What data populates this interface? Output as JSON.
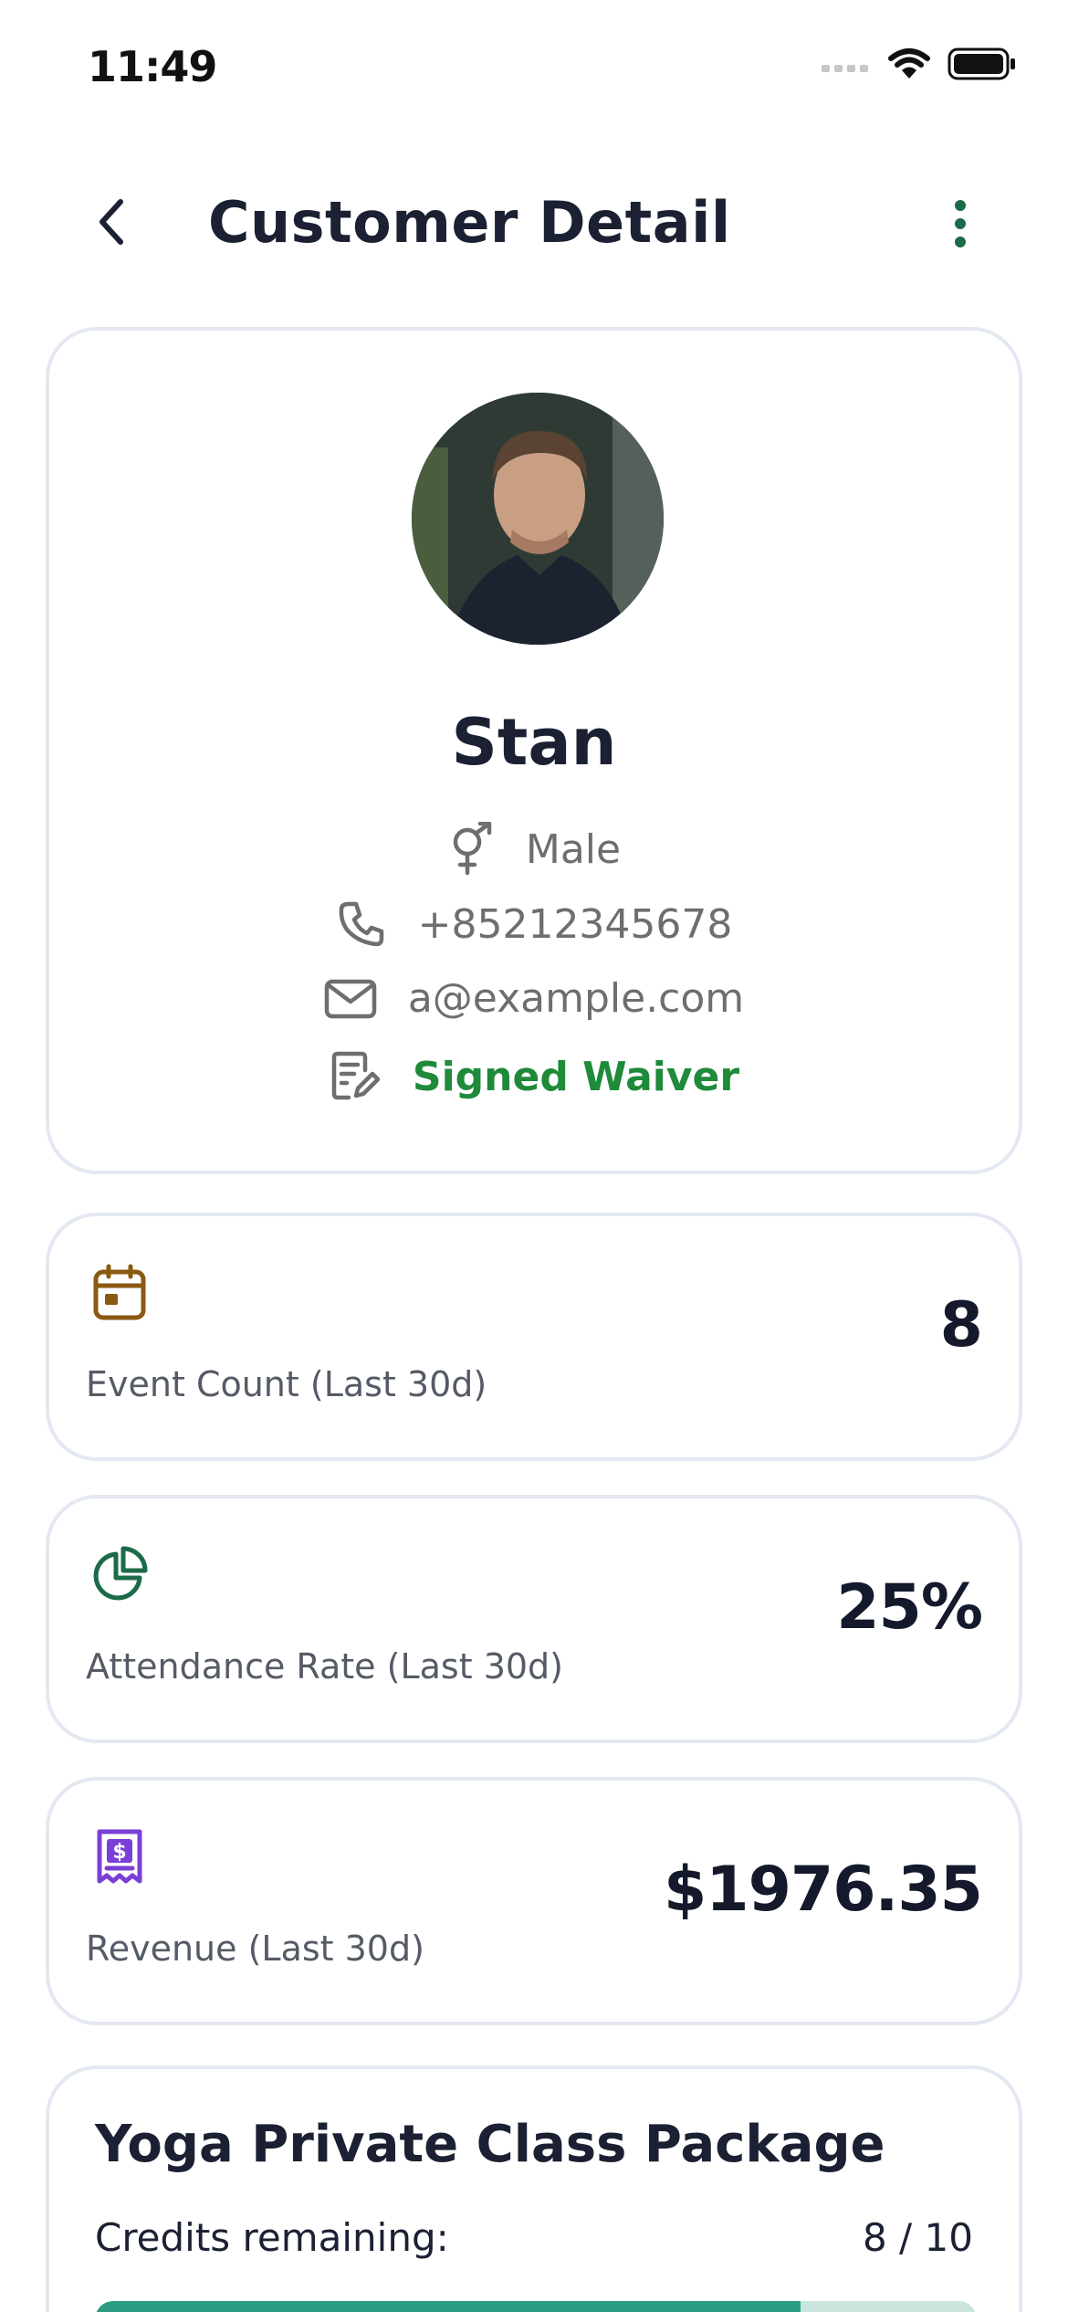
{
  "status_bar": {
    "time": "11:49"
  },
  "header": {
    "title": "Customer Detail"
  },
  "profile": {
    "name": "Stan",
    "gender": "Male",
    "phone": "+85212345678",
    "email": "a@example.com",
    "waiver": "Signed Waiver"
  },
  "stats": [
    {
      "label": "Event Count (Last 30d)",
      "value": "8",
      "icon": "calendar-icon",
      "color": "#8a5a12"
    },
    {
      "label": "Attendance Rate (Last 30d)",
      "value": "25%",
      "icon": "pie-chart-icon",
      "color": "#1c6b48"
    },
    {
      "label": "Revenue (Last 30d)",
      "value": "$1976.35",
      "icon": "receipt-icon",
      "color": "#7a3fd6"
    }
  ],
  "package": {
    "title": "Yoga Private Class Package",
    "credits_label": "Credits remaining:",
    "credits_value": "8 / 10",
    "credits_fraction": 0.8
  },
  "colors": {
    "accent_green": "#1e8a3a",
    "progress_fill": "#2c9c84",
    "progress_track": "#c9e5dd",
    "card_border": "#e3e8f2",
    "menu_dots": "#1c6b48"
  }
}
